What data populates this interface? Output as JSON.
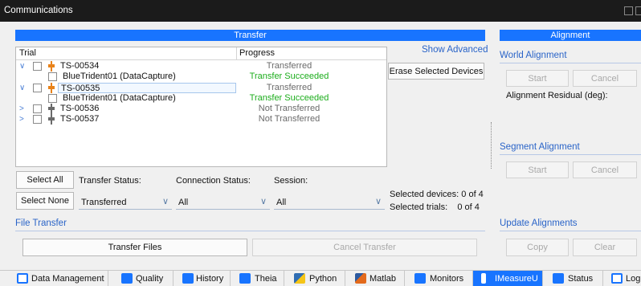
{
  "window": {
    "title": "Communications"
  },
  "transfer": {
    "header": "Transfer",
    "show_advanced": "Show Advanced",
    "columns": {
      "trial": "Trial",
      "progress": "Progress"
    },
    "rows": [
      {
        "chevron": "∨",
        "name": "TS-00534",
        "status": "Transferred"
      },
      {
        "chevron": "",
        "name": "BlueTrident01 (DataCapture)",
        "status": "Transfer Succeeded"
      },
      {
        "chevron": "∨",
        "name": "TS-00535",
        "status": "Transferred"
      },
      {
        "chevron": "",
        "name": "BlueTrident01 (DataCapture)",
        "status": "Transfer Succeeded"
      },
      {
        "chevron": ">",
        "name": "TS-00536",
        "status": "Not Transferred"
      },
      {
        "chevron": ">",
        "name": "TS-00537",
        "status": "Not Transferred"
      }
    ],
    "erase_button": "Erase Selected Devices",
    "select_all": "Select All",
    "select_none": "Select None",
    "transfer_status_label": "Transfer Status:",
    "connection_status_label": "Connection Status:",
    "session_label": "Session:",
    "transfer_status_value": "Transferred",
    "connection_status_value": "All",
    "session_value": "All",
    "selected_devices": "Selected devices: 0 of 4",
    "selected_trials": "Selected trials:    0 of 4"
  },
  "file_transfer": {
    "header": "File Transfer",
    "transfer_files": "Transfer Files",
    "cancel_transfer": "Cancel Transfer"
  },
  "alignment": {
    "header": "Alignment",
    "world_alignment": "World Alignment",
    "start": "Start",
    "cancel": "Cancel",
    "residual_label": "Alignment Residual (deg):",
    "segment_alignment": "Segment Alignment",
    "segment_start": "Start",
    "segment_cancel": "Cancel",
    "update_alignments": "Update Alignments",
    "copy": "Copy",
    "clear": "Clear"
  },
  "tabs": [
    {
      "label": "Data Management",
      "icon": "folder-icon"
    },
    {
      "label": "Quality",
      "icon": "quality-icon"
    },
    {
      "label": "History",
      "icon": "history-icon"
    },
    {
      "label": "Theia",
      "icon": "theia-icon"
    },
    {
      "label": "Python",
      "icon": "python-icon"
    },
    {
      "label": "Matlab",
      "icon": "matlab-icon"
    },
    {
      "label": "Monitors",
      "icon": "monitor-icon"
    },
    {
      "label": "IMeasureU",
      "icon": "imu-icon"
    },
    {
      "label": "Status",
      "icon": "plus-icon"
    },
    {
      "label": "Log",
      "icon": "log-icon"
    }
  ],
  "colors": {
    "accent": "#1874FF",
    "success": "#1CAD1C",
    "muted": "#6A6A6A",
    "link": "#2A64C8",
    "titlebar": "#1B1B1B"
  }
}
